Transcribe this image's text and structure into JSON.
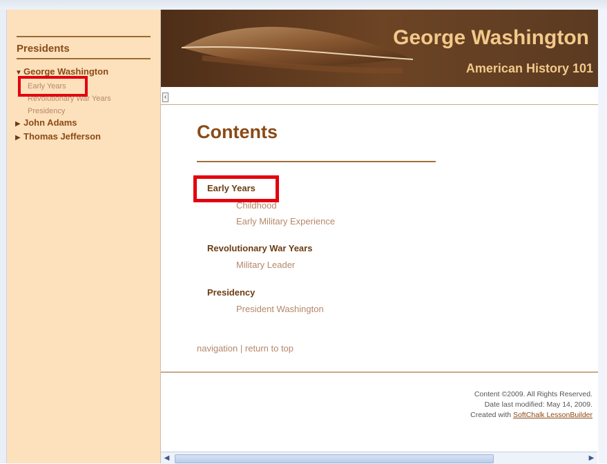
{
  "sidebar": {
    "title": "Presidents",
    "tree": [
      {
        "label": "George Washington",
        "expanded": true,
        "children": [
          "Early Years",
          "Revolutionary War Years",
          "Presidency"
        ]
      },
      {
        "label": "John Adams",
        "expanded": false
      },
      {
        "label": "Thomas Jefferson",
        "expanded": false
      }
    ]
  },
  "banner": {
    "title": "George Washington",
    "subtitle": "American History 101"
  },
  "main": {
    "heading": "Contents",
    "sections": [
      {
        "title": "Early Years",
        "items": [
          "Childhood",
          "Early Military Experience"
        ]
      },
      {
        "title": "Revolutionary War Years",
        "items": [
          "Military Leader"
        ]
      },
      {
        "title": "Presidency",
        "items": [
          "President Washington"
        ]
      }
    ],
    "nav_link": "navigation",
    "nav_separator": "|",
    "return_link": "return to top"
  },
  "footer": {
    "copyright": "Content ©2009. All Rights Reserved.",
    "modified": "Date last modified: May 14, 2009.",
    "created_prefix": "Created with",
    "created_link": "SoftChalk LessonBuilder"
  },
  "colors": {
    "accent": "#8a4a16",
    "sidebar_bg": "#fde0bc",
    "banner_bg": "#5a3a22",
    "highlight": "#e3000f"
  }
}
